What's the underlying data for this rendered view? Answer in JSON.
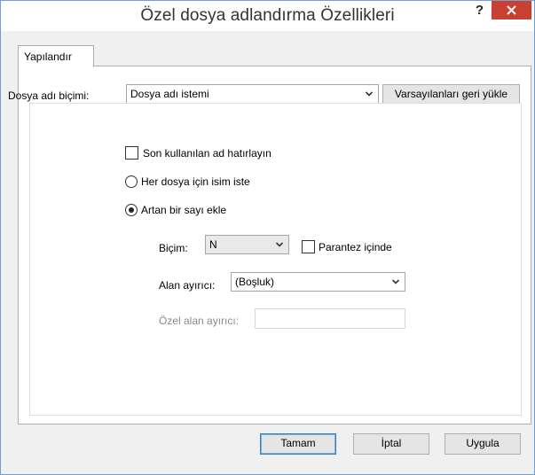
{
  "window": {
    "title": "Özel dosya adlandırma Özellikleri",
    "help_label": "?"
  },
  "tabs": [
    {
      "label": "Yapılandır",
      "active": true
    }
  ],
  "filename_format": {
    "label": "Dosya adı biçimi:",
    "selected": "Dosya adı istemi",
    "restore_button": "Varsayılanları geri yükle"
  },
  "options": {
    "remember_last": {
      "label": "Son kullanılan ad hatırlayın",
      "checked": false
    },
    "ask_each_file": {
      "label": "Her dosya için isim iste",
      "selected": false
    },
    "add_increment": {
      "label": "Artan bir sayı ekle",
      "selected": true
    }
  },
  "increment": {
    "format_label": "Biçim:",
    "format_value": "N",
    "parentheses": {
      "label": "Parantez içinde",
      "checked": false
    },
    "separator_label": "Alan ayırıcı:",
    "separator_value": "(Boşluk)",
    "custom_separator_label": "Özel alan ayırıcı:",
    "custom_separator_value": ""
  },
  "footer": {
    "ok": "Tamam",
    "cancel": "İptal",
    "apply": "Uygula"
  },
  "colors": {
    "close_button": "#c84031",
    "default_button_border": "#3c7fb1",
    "disabled_text": "#8a8a8a"
  }
}
